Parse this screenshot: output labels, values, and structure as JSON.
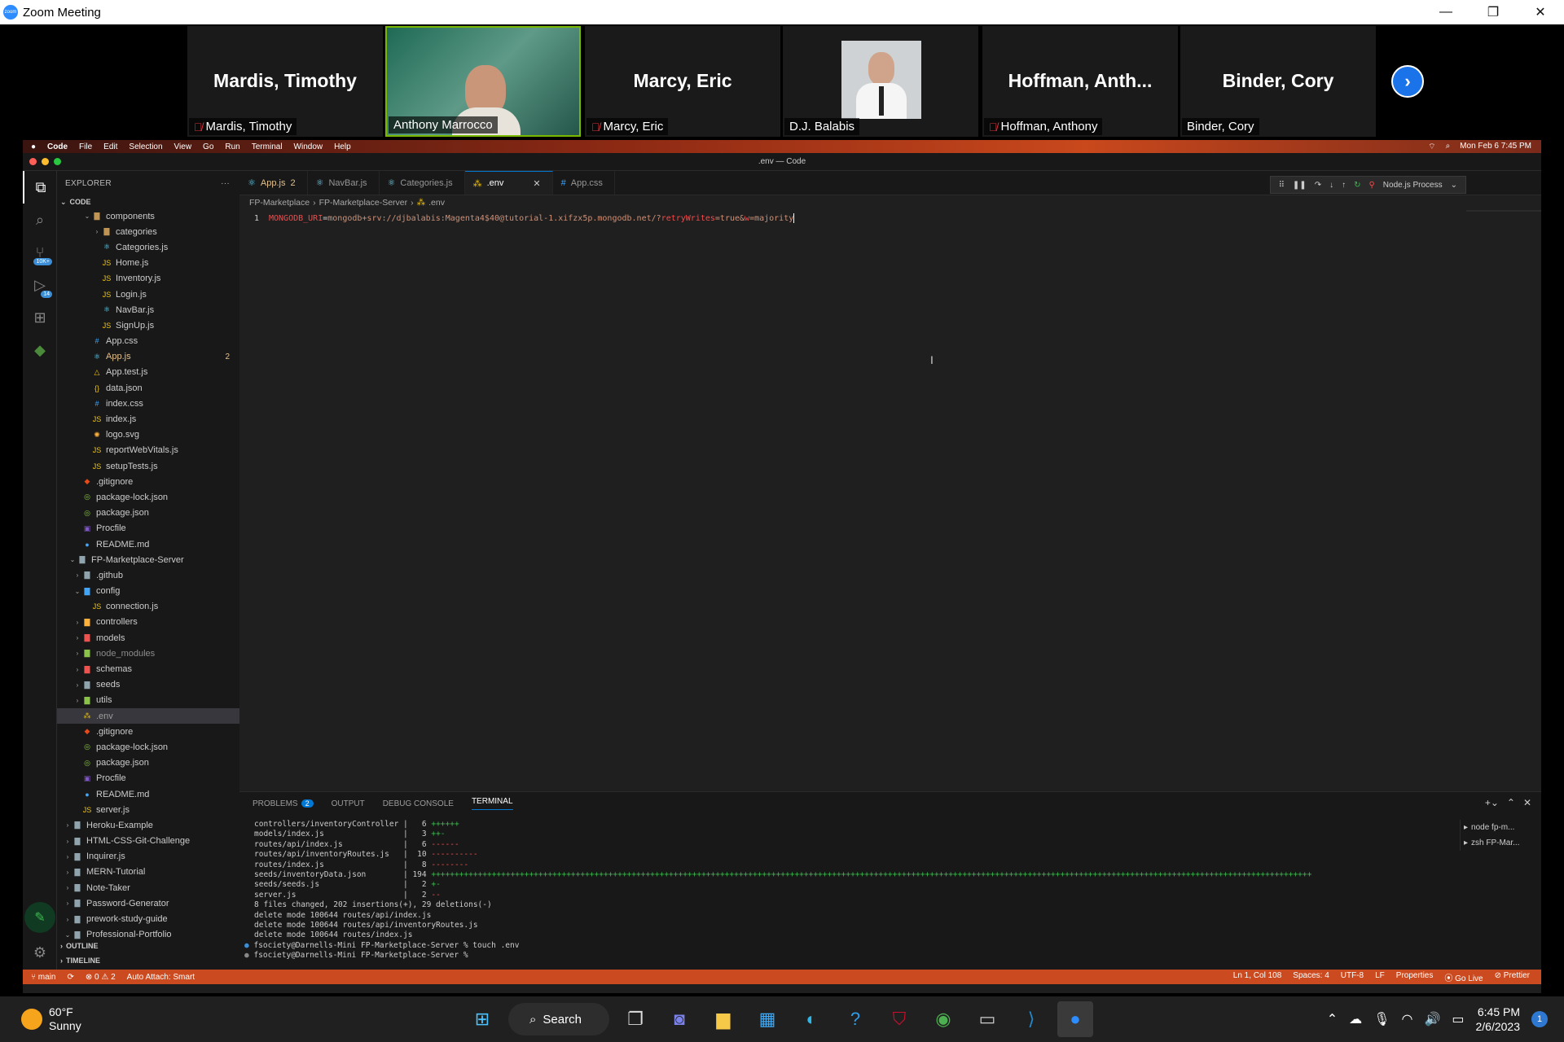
{
  "zoom": {
    "title": "Zoom Meeting",
    "logo_text": "zoom",
    "window_controls": [
      "—",
      "❐",
      "✕"
    ],
    "participants": [
      {
        "big_name": "Mardis, Timothy",
        "label": "Mardis, Timothy",
        "muted": true,
        "video": false
      },
      {
        "big_name": "",
        "label": "Anthony Marrocco",
        "muted": false,
        "video": true
      },
      {
        "big_name": "Marcy, Eric",
        "label": "Marcy, Eric",
        "muted": true,
        "video": false
      },
      {
        "big_name": "",
        "label": "D.J. Balabis",
        "muted": false,
        "video": true
      },
      {
        "big_name": "Hoffman,  Anth...",
        "label": "Hoffman, Anthony",
        "muted": true,
        "video": false
      },
      {
        "big_name": "Binder, Cory",
        "label": "Binder, Cory",
        "muted": false,
        "video": false
      }
    ],
    "next_icon": "›"
  },
  "mac_menubar": {
    "items": [
      "",
      "Code",
      "File",
      "Edit",
      "Selection",
      "View",
      "Go",
      "Run",
      "Terminal",
      "Window",
      "Help"
    ],
    "datetime": "Mon Feb 6  7:45 PM"
  },
  "vscode": {
    "window_title": ".env — Code",
    "activity": [
      {
        "name": "explorer-icon",
        "glyph": "⧉",
        "badge": ""
      },
      {
        "name": "search-icon",
        "glyph": "⌕",
        "badge": ""
      },
      {
        "name": "source-control-icon",
        "glyph": "⑂",
        "badge": "10K+"
      },
      {
        "name": "run-debug-icon",
        "glyph": "▷",
        "badge": "14"
      },
      {
        "name": "extensions-icon",
        "glyph": "⊞",
        "badge": ""
      },
      {
        "name": "mongodb-icon",
        "glyph": "◆",
        "badge": ""
      }
    ],
    "explorer": {
      "header": "EXPLORER",
      "root": "CODE",
      "items": [
        {
          "label": "components",
          "indent": 2,
          "chev": "⌄",
          "icon": "▇",
          "color": "#c09553"
        },
        {
          "label": "categories",
          "indent": 3,
          "chev": "›",
          "icon": "▇",
          "color": "#c09553"
        },
        {
          "label": "Categories.js",
          "indent": 3,
          "chev": "",
          "icon": "⚛",
          "color": "#61dafb"
        },
        {
          "label": "Home.js",
          "indent": 3,
          "chev": "",
          "icon": "JS",
          "color": "#f1c40f"
        },
        {
          "label": "Inventory.js",
          "indent": 3,
          "chev": "",
          "icon": "JS",
          "color": "#f1c40f"
        },
        {
          "label": "Login.js",
          "indent": 3,
          "chev": "",
          "icon": "JS",
          "color": "#f1c40f"
        },
        {
          "label": "NavBar.js",
          "indent": 3,
          "chev": "",
          "icon": "⚛",
          "color": "#61dafb"
        },
        {
          "label": "SignUp.js",
          "indent": 3,
          "chev": "",
          "icon": "JS",
          "color": "#f1c40f"
        },
        {
          "label": "App.css",
          "indent": 2,
          "chev": "",
          "icon": "#",
          "color": "#42a5f5"
        },
        {
          "label": "App.js",
          "indent": 2,
          "chev": "",
          "icon": "⚛",
          "color": "#61dafb",
          "err": "2",
          "text_color": "#e2c08d"
        },
        {
          "label": "App.test.js",
          "indent": 2,
          "chev": "",
          "icon": "△",
          "color": "#f1c40f"
        },
        {
          "label": "data.json",
          "indent": 2,
          "chev": "",
          "icon": "{}",
          "color": "#f1c40f"
        },
        {
          "label": "index.css",
          "indent": 2,
          "chev": "",
          "icon": "#",
          "color": "#42a5f5"
        },
        {
          "label": "index.js",
          "indent": 2,
          "chev": "",
          "icon": "JS",
          "color": "#f1c40f"
        },
        {
          "label": "logo.svg",
          "indent": 2,
          "chev": "",
          "icon": "✺",
          "color": "#ffb13b"
        },
        {
          "label": "reportWebVitals.js",
          "indent": 2,
          "chev": "",
          "icon": "JS",
          "color": "#f1c40f"
        },
        {
          "label": "setupTests.js",
          "indent": 2,
          "chev": "",
          "icon": "JS",
          "color": "#f1c40f"
        },
        {
          "label": ".gitignore",
          "indent": 1,
          "chev": "",
          "icon": "◆",
          "color": "#e64a19"
        },
        {
          "label": "package-lock.json",
          "indent": 1,
          "chev": "",
          "icon": "◎",
          "color": "#8bc34a"
        },
        {
          "label": "package.json",
          "indent": 1,
          "chev": "",
          "icon": "◎",
          "color": "#8bc34a"
        },
        {
          "label": "Procfile",
          "indent": 1,
          "chev": "",
          "icon": "▣",
          "color": "#7e57c2"
        },
        {
          "label": "README.md",
          "indent": 1,
          "chev": "",
          "icon": "●",
          "color": "#42a5f5"
        },
        {
          "label": "FP-Marketplace-Server",
          "indent": 0.5,
          "chev": "⌄",
          "icon": "▇",
          "color": "#90a4ae"
        },
        {
          "label": ".github",
          "indent": 1,
          "chev": "›",
          "icon": "▇",
          "color": "#90a4ae"
        },
        {
          "label": "config",
          "indent": 1,
          "chev": "⌄",
          "icon": "▇",
          "color": "#42a5f5"
        },
        {
          "label": "connection.js",
          "indent": 2,
          "chev": "",
          "icon": "JS",
          "color": "#f1c40f"
        },
        {
          "label": "controllers",
          "indent": 1,
          "chev": "›",
          "icon": "▇",
          "color": "#ffb13b"
        },
        {
          "label": "models",
          "indent": 1,
          "chev": "›",
          "icon": "▇",
          "color": "#ef5350"
        },
        {
          "label": "node_modules",
          "indent": 1,
          "chev": "›",
          "icon": "▇",
          "color": "#8bc34a",
          "text_color": "#8c8c8c"
        },
        {
          "label": "schemas",
          "indent": 1,
          "chev": "›",
          "icon": "▇",
          "color": "#ef5350"
        },
        {
          "label": "seeds",
          "indent": 1,
          "chev": "›",
          "icon": "▇",
          "color": "#90a4ae"
        },
        {
          "label": "utils",
          "indent": 1,
          "chev": "›",
          "icon": "▇",
          "color": "#8bc34a"
        },
        {
          "label": ".env",
          "indent": 1,
          "chev": "",
          "icon": "⁂",
          "color": "#f1c40f",
          "selected": true,
          "text_color": "#9d9d9d"
        },
        {
          "label": ".gitignore",
          "indent": 1,
          "chev": "",
          "icon": "◆",
          "color": "#e64a19"
        },
        {
          "label": "package-lock.json",
          "indent": 1,
          "chev": "",
          "icon": "◎",
          "color": "#8bc34a"
        },
        {
          "label": "package.json",
          "indent": 1,
          "chev": "",
          "icon": "◎",
          "color": "#8bc34a"
        },
        {
          "label": "Procfile",
          "indent": 1,
          "chev": "",
          "icon": "▣",
          "color": "#7e57c2"
        },
        {
          "label": "README.md",
          "indent": 1,
          "chev": "",
          "icon": "●",
          "color": "#42a5f5"
        },
        {
          "label": "server.js",
          "indent": 1,
          "chev": "",
          "icon": "JS",
          "color": "#f1c40f"
        },
        {
          "label": "Heroku-Example",
          "indent": 0,
          "chev": "›",
          "icon": "▇",
          "color": "#90a4ae"
        },
        {
          "label": "HTML-CSS-Git-Challenge",
          "indent": 0,
          "chev": "›",
          "icon": "▇",
          "color": "#90a4ae"
        },
        {
          "label": "Inquirer.js",
          "indent": 0,
          "chev": "›",
          "icon": "▇",
          "color": "#90a4ae"
        },
        {
          "label": "MERN-Tutorial",
          "indent": 0,
          "chev": "›",
          "icon": "▇",
          "color": "#90a4ae"
        },
        {
          "label": "Note-Taker",
          "indent": 0,
          "chev": "›",
          "icon": "▇",
          "color": "#90a4ae"
        },
        {
          "label": "Password-Generator",
          "indent": 0,
          "chev": "›",
          "icon": "▇",
          "color": "#90a4ae"
        },
        {
          "label": "prework-study-guide",
          "indent": 0,
          "chev": "›",
          "icon": "▇",
          "color": "#90a4ae"
        },
        {
          "label": "Professional-Portfolio",
          "indent": 0,
          "chev": "⌄",
          "icon": "▇",
          "color": "#90a4ae"
        }
      ],
      "outline": "OUTLINE",
      "timeline": "TIMELINE"
    },
    "tabs": [
      {
        "label": "App.js",
        "icon": "⚛",
        "color": "#61dafb",
        "mod": "2",
        "active": false,
        "text_color": "#e2c08d"
      },
      {
        "label": "NavBar.js",
        "icon": "⚛",
        "color": "#61dafb",
        "mod": "",
        "active": false
      },
      {
        "label": "Categories.js",
        "icon": "⚛",
        "color": "#61dafb",
        "mod": "",
        "active": false
      },
      {
        "label": ".env",
        "icon": "⁂",
        "color": "#f1c40f",
        "mod": "✕",
        "active": true
      },
      {
        "label": "App.css",
        "icon": "#",
        "color": "#42a5f5",
        "mod": "",
        "active": false
      }
    ],
    "debug_toolbar": {
      "controls": [
        "⠿",
        "❚❚",
        "↷",
        "↓",
        "↑",
        "↻",
        "⚲"
      ],
      "process": "Node.js Process"
    },
    "breadcrumb": [
      "FP-Marketplace",
      "FP-Marketplace-Server",
      ".env"
    ],
    "code": {
      "line_number": "1",
      "key": "MONGODB_URI",
      "eq": "=",
      "value_pre": "mongodb+srv://djbalabis:Magenta4$40@tutorial-1.xifzx5p.mongodb.net/?",
      "k2": "retryWrites",
      "v2": "=true&",
      "k3": "w",
      "v3": "=majority"
    },
    "panel": {
      "tabs": [
        "PROBLEMS",
        "OUTPUT",
        "DEBUG CONSOLE",
        "TERMINAL"
      ],
      "problems_count": "2",
      "terminal_lines": [
        {
          "text": "controllers/inventoryController |   6 ",
          "bar": "++++++",
          "bar_type": "plus"
        },
        {
          "text": "models/index.js                 |   3 ",
          "bar": "++-",
          "bar_type": "mixed"
        },
        {
          "text": "routes/api/index.js             |   6 ",
          "bar": "------",
          "bar_type": "minus"
        },
        {
          "text": "routes/api/inventoryRoutes.js   |  10 ",
          "bar": "----------",
          "bar_type": "minus"
        },
        {
          "text": "routes/index.js                 |   8 ",
          "bar": "--------",
          "bar_type": "minus"
        },
        {
          "text": "seeds/inventoryData.json        | 194 ",
          "bar": "+++++++++++++++++++++++++++++++++++++++++++++++++++++++++++++++++++++++++++++++++++++++++++++++++++++++++++++++++++++++++++++++++++++++++++++++++++++++++++++++++++++++++++++++++++++++++++++",
          "bar_type": "plus"
        },
        {
          "text": "seeds/seeds.js                  |   2 ",
          "bar": "+-",
          "bar_type": "mixed"
        },
        {
          "text": "server.js                       |   2 ",
          "bar": "--",
          "bar_type": "minus"
        },
        {
          "text": "8 files changed, 202 insertions(+), 29 deletions(-)",
          "bar": "",
          "bar_type": ""
        },
        {
          "text": "delete mode 100644 routes/api/index.js",
          "bar": "",
          "bar_type": ""
        },
        {
          "text": "delete mode 100644 routes/api/inventoryRoutes.js",
          "bar": "",
          "bar_type": ""
        },
        {
          "text": "delete mode 100644 routes/index.js",
          "bar": "",
          "bar_type": ""
        }
      ],
      "prompt1": "fsociety@Darnells-Mini FP-Marketplace-Server % touch .env",
      "prompt2": "fsociety@Darnells-Mini FP-Marketplace-Server % ",
      "terminals": [
        "node  fp-m...",
        "zsh  FP-Mar..."
      ]
    },
    "status": {
      "branch": "main",
      "sync": "⟳",
      "problems": "⊗ 0 ⚠ 2",
      "attach": "Auto Attach: Smart",
      "right": [
        "Ln 1, Col 108",
        "Spaces: 4",
        "UTF-8",
        "LF",
        "Properties",
        "⦿ Go Live",
        "⊘ Prettier"
      ]
    }
  },
  "taskbar": {
    "temp": "60°F",
    "condition": "Sunny",
    "search_label": "Search",
    "time": "6:45 PM",
    "date": "2/6/2023",
    "notif_count": "1",
    "apps": [
      {
        "name": "windows-start-icon",
        "glyph": "⊞",
        "color": "#4cc2ff"
      },
      {
        "name": "task-view-icon",
        "glyph": "❐",
        "color": "#ddd"
      },
      {
        "name": "teams-chat-icon",
        "glyph": "◙",
        "color": "#7b83eb"
      },
      {
        "name": "file-explorer-icon",
        "glyph": "▆",
        "color": "#f7c948"
      },
      {
        "name": "store-icon",
        "glyph": "▦",
        "color": "#3fa9f5"
      },
      {
        "name": "edge-icon",
        "glyph": "◐",
        "color": "#2fb5e8"
      },
      {
        "name": "help-icon",
        "glyph": "?",
        "color": "#2f9de8"
      },
      {
        "name": "mcafee-icon",
        "glyph": "⛉",
        "color": "#c8102e"
      },
      {
        "name": "chrome-icon",
        "glyph": "◉",
        "color": "#4caf50"
      },
      {
        "name": "terminal-icon",
        "glyph": "▭",
        "color": "#ccc"
      },
      {
        "name": "vscode-icon",
        "glyph": "⟩",
        "color": "#2489ca"
      },
      {
        "name": "zoom-icon",
        "glyph": "●",
        "color": "#2d8cff"
      }
    ]
  }
}
